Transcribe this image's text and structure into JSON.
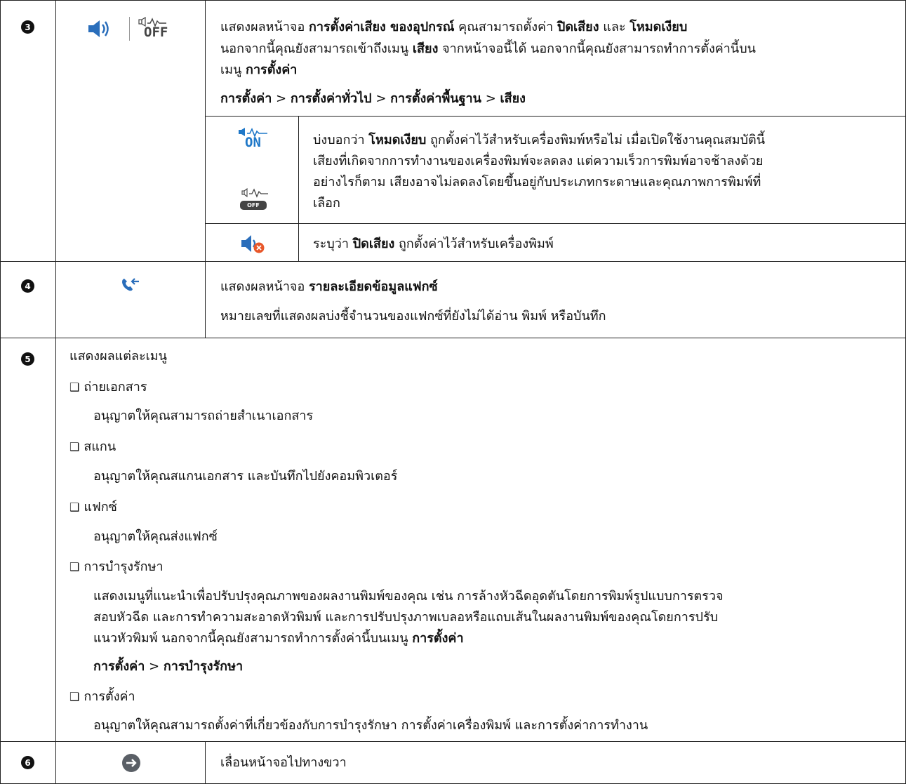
{
  "rows": {
    "r3": {
      "number": "3",
      "icon_off_text": "OFF",
      "desc": {
        "l1_a": "แสดงผลหน้าจอ ",
        "l1_b": "การตั้งค่าเสียง ของอุปกรณ์",
        "l1_c": " คุณสามารถตั้งค่า ",
        "l1_d": "ปิดเสียง",
        "l1_e": " และ ",
        "l1_f": "โหมดเงียบ",
        "l2": "นอกจากนี้คุณยังสามารถเข้าถึงเมนู ",
        "l2_b": "เสียง",
        "l2_c": " จากหน้าจอนี้ได้ นอกจากนี้คุณยังสามารถทำการตั้งค่านี้บน",
        "l3_a": "เมนู ",
        "l3_b": "การตั้งค่า"
      },
      "path": {
        "p1": "การตั้งค่า",
        "p2": "การตั้งค่าทั่วไป",
        "p3": "การตั้งค่าพื้นฐาน",
        "p4": "เสียง",
        "sep": " > "
      },
      "sub": {
        "quiet": {
          "on_text": "ON",
          "off_text": "OFF",
          "l1_a": "บ่งบอกว่า ",
          "l1_b": "โหมดเงียบ",
          "l1_c": " ถูกตั้งค่าไว้สำหรับเครื่องพิมพ์หรือไม่ เมื่อเปิดใช้งานคุณสมบัตินี้",
          "l2": "เสียงที่เกิดจากการทำงานของเครื่องพิมพ์จะลดลง แต่ความเร็วการพิมพ์อาจช้าลงด้วย",
          "l3": "อย่างไรก็ตาม เสียงอาจไม่ลดลงโดยขึ้นอยู่กับประเภทกระดาษและคุณภาพการพิมพ์ที่",
          "l4": "เลือก"
        },
        "mute": {
          "a": "ระบุว่า ",
          "b": "ปิดเสียง",
          "c": " ถูกตั้งค่าไว้สำหรับเครื่องพิมพ์"
        }
      }
    },
    "r4": {
      "number": "4",
      "l1_a": "แสดงผลหน้าจอ ",
      "l1_b": "รายละเอียดข้อมูลแฟกซ์",
      "l2": "หมายเลขที่แสดงผลบ่งชี้จำนวนของแฟกซ์ที่ยังไม่ได้อ่าน พิมพ์ หรือบันทึก"
    },
    "r5": {
      "number": "5",
      "intro": "แสดงผลแต่ละเมนู",
      "checkbox": "❑",
      "items": [
        {
          "title": "ถ่ายเอกสาร",
          "desc": "อนุญาตให้คุณสามารถถ่ายสำเนาเอกสาร"
        },
        {
          "title": "สแกน",
          "desc": "อนุญาตให้คุณสแกนเอกสาร และบันทึกไปยังคอมพิวเตอร์"
        },
        {
          "title": "แฟกซ์",
          "desc": "อนุญาตให้คุณส่งแฟกซ์"
        },
        {
          "title": "การบำรุงรักษา"
        },
        {
          "title": "การตั้งค่า",
          "desc": "อนุญาตให้คุณสามารถตั้งค่าที่เกี่ยวข้องกับการบำรุงรักษา การตั้งค่าเครื่องพิมพ์ และการตั้งค่าการทำงาน"
        }
      ],
      "maint": {
        "l1": "แสดงเมนูที่แนะนำเพื่อปรับปรุงคุณภาพของผลงานพิมพ์ของคุณ เช่น การล้างหัวฉีดอุดตันโดยการพิมพ์รูปแบบการตรวจ",
        "l2": "สอบหัวฉีด และการทำความสะอาดหัวพิมพ์ และการปรับปรุงภาพเบลอหรือแถบเส้นในผลงานพิมพ์ของคุณโดยการปรับ",
        "l3_a": "แนวหัวพิมพ์ นอกจากนี้คุณยังสามารถทำการตั้งค่านี้บนเมนู ",
        "l3_b": "การตั้งค่า",
        "p1": "การตั้งค่า",
        "sep": " > ",
        "p2": "การบำรุงรักษา"
      }
    },
    "r6": {
      "number": "6",
      "desc": "เลื่อนหน้าจอไปทางขวา"
    }
  },
  "colors": {
    "icon_blue": "#2a6ebb",
    "mute_orange": "#e8572a",
    "arrow_gray": "#5a5f66",
    "rule": "#222222"
  }
}
